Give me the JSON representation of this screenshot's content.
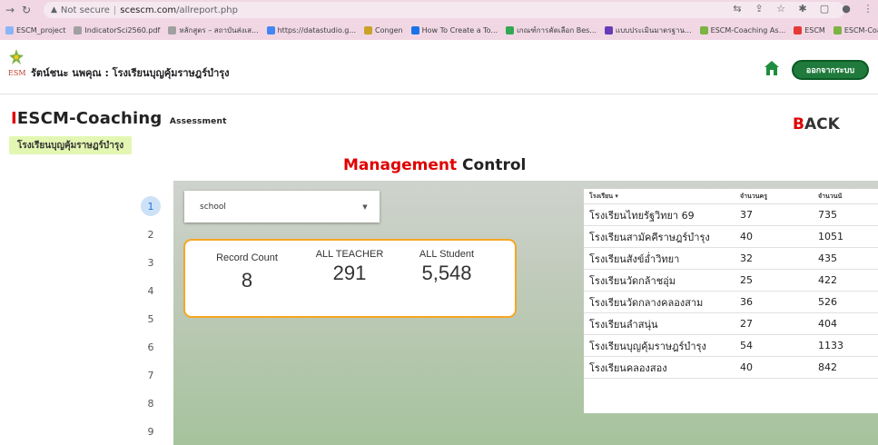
{
  "browser": {
    "security_label": "Not secure",
    "url_host": "scescm.com",
    "url_path": "/allreport.php",
    "bookmarks": [
      {
        "label": "ESCM_project",
        "color": "#8ab4f8"
      },
      {
        "label": "IndicatorSci2560.pdf",
        "color": "#a0a0a0"
      },
      {
        "label": "หลักสูตร – สถาบันส่งเส...",
        "color": "#a0a0a0"
      },
      {
        "label": "https://datastudio.g...",
        "color": "#4285f4"
      },
      {
        "label": "Congen",
        "color": "#c9a227"
      },
      {
        "label": "How To Create a To...",
        "color": "#1a73e8"
      },
      {
        "label": "เกณฑ์การคัดเลือก Bes...",
        "color": "#34a853"
      },
      {
        "label": "แบบประเมินมาตรฐาน...",
        "color": "#673ab7"
      },
      {
        "label": "ESCM-Coaching As...",
        "color": "#7cb342"
      },
      {
        "label": "ESCM",
        "color": "#e53935"
      },
      {
        "label": "ESCM-Coaching As...",
        "color": "#7cb342"
      }
    ]
  },
  "header": {
    "user_school": "รัตน์ชนะ นพคุณ : โรงเรียนบุญคุ้มราษฎร์บำรุง",
    "logout_label": "ออกจากระบบ",
    "home_icon": "home-icon"
  },
  "page": {
    "brand_bar": "I",
    "brand_name": "ESCM-Coaching",
    "brand_sub": "Assessment",
    "school_tag": "โรงเรียนบุญคุ้มราษฎร์บำรุง",
    "back_first": "B",
    "back_rest": "ACK",
    "title_red": "Management",
    "title_rest": " Control"
  },
  "pager": [
    "1",
    "2",
    "3",
    "4",
    "5",
    "6",
    "7",
    "8",
    "9"
  ],
  "filter": {
    "value": "school"
  },
  "kpis": {
    "record_count_label": "Record Count",
    "record_count_value": "8",
    "teacher_label": "ALL TEACHER",
    "teacher_value": "291",
    "student_label": "ALL Student",
    "student_value": "5,548"
  },
  "table": {
    "headers": [
      "โรงเรียน ▾",
      "จำนวนครู",
      "จำนวนนั"
    ],
    "rows": [
      [
        "โรงเรียนไทยรัฐวิทยา 69",
        "37",
        "735"
      ],
      [
        "โรงเรียนสามัคคีราษฎร์บำรุง",
        "40",
        "1051"
      ],
      [
        "โรงเรียนสังข์อ่ำวิทยา",
        "32",
        "435"
      ],
      [
        "โรงเรียนวัดกล้าชอุ่ม",
        "25",
        "422"
      ],
      [
        "โรงเรียนวัดกลางคลองสาม",
        "36",
        "526"
      ],
      [
        "โรงเรียนลำสนุ่น",
        "27",
        "404"
      ],
      [
        "โรงเรียนบุญคุ้มราษฎร์บำรุง",
        "54",
        "1133"
      ],
      [
        "โรงเรียนคลองสอง",
        "40",
        "842"
      ]
    ]
  },
  "colors": {
    "accent_red": "#e00000",
    "logout_green": "#1f7a3c",
    "card_border": "#f5a623"
  }
}
